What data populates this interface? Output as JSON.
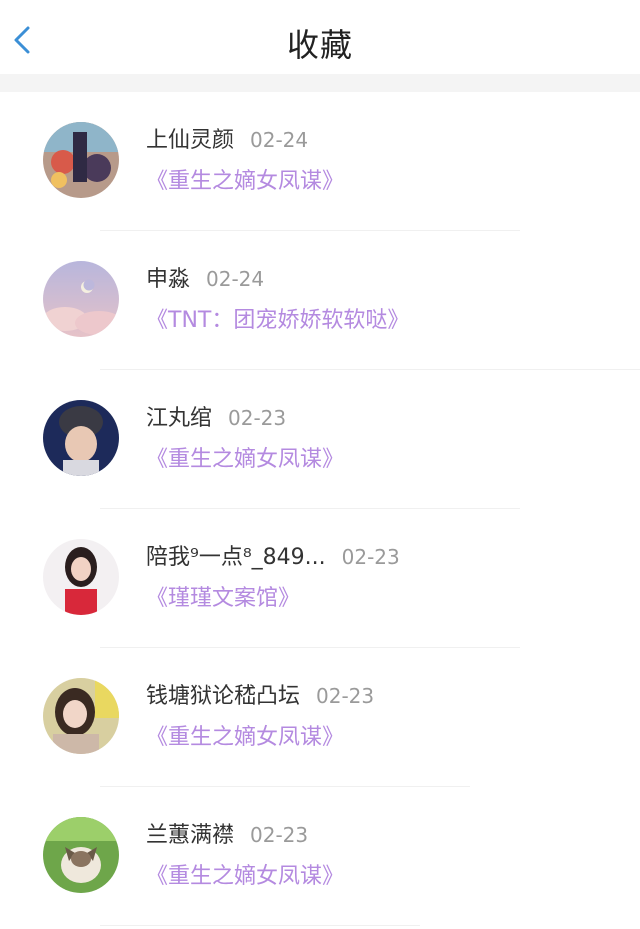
{
  "header": {
    "title": "收藏",
    "back_icon": "chevron-left-icon"
  },
  "colors": {
    "accent": "#3b8fd6",
    "book_link": "#b48ae0",
    "date": "#9a9a9a",
    "separator": "#f4f4f4"
  },
  "items": [
    {
      "username": "上仙灵颜",
      "date": "02-24",
      "book": "《重生之嫡女凤谋》"
    },
    {
      "username": "申淼",
      "date": "02-24",
      "book": "《TNT：团宠娇娇软软哒》"
    },
    {
      "username": "江丸绾",
      "date": "02-23",
      "book": "《重生之嫡女凤谋》"
    },
    {
      "username": "陪我⁹一点⁸_849...",
      "date": "02-23",
      "book": "《瑾瑾文案馆》"
    },
    {
      "username": "钱塘狱论嵇凸坛",
      "date": "02-23",
      "book": "《重生之嫡女凤谋》"
    },
    {
      "username": "兰蕙满襟",
      "date": "02-23",
      "book": "《重生之嫡女凤谋》"
    }
  ]
}
